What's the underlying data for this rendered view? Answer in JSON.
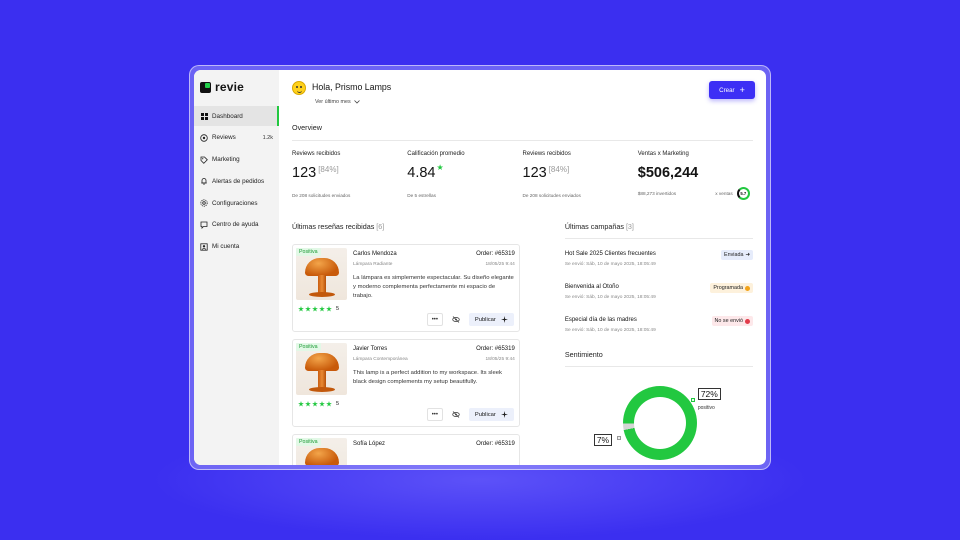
{
  "app": {
    "name": "revie"
  },
  "sidebar": {
    "items": [
      {
        "label": "Dashboard",
        "icon": "grid-icon",
        "active": true
      },
      {
        "label": "Reviews",
        "icon": "star-circle-icon",
        "badge": "1.2k"
      },
      {
        "label": "Marketing",
        "icon": "tag-icon"
      },
      {
        "label": "Alertas de pedidos",
        "icon": "bell-icon"
      },
      {
        "label": "Configuraciones",
        "icon": "gear-icon"
      },
      {
        "label": "Centro de ayuda",
        "icon": "help-chat-icon"
      },
      {
        "label": "Mi cuenta",
        "icon": "user-icon"
      }
    ]
  },
  "header": {
    "greeting": "Hola, Prismo Lamps",
    "period": "Ver último mes",
    "create_label": "Crear"
  },
  "overview": {
    "title": "Overview",
    "stats": [
      {
        "label": "Reviews recibidos",
        "value": "123",
        "pct": "[84%]",
        "foot": "De 208 solicitudes enviados"
      },
      {
        "label": "Calificación promedio",
        "value": "4.84",
        "star": "★",
        "foot": "De 5 estrellas"
      },
      {
        "label": "Reviews recibidos",
        "value": "123",
        "pct": "[84%]",
        "foot": "De 208 solicitudes enviados"
      },
      {
        "label": "Ventas x Marketing",
        "value": "$506,244",
        "foot": "$88,273 invertidos",
        "foot2": "x ventas",
        "ratio": "5.7"
      }
    ]
  },
  "reviews": {
    "title": "Últimas reseñas recibidas",
    "count": "[6]",
    "items": [
      {
        "sentiment": "Positiva",
        "name": "Carlos Mendoza",
        "order": "Order: #65319",
        "product": "Lámpara Radiante",
        "date": "18/05/25 9:44",
        "text": "La lámpara es simplemente espectacular. Su diseño elegante y moderno complementa perfectamente mi espacio de trabajo.",
        "rating": "5",
        "more": "•••",
        "publish": "Publicar"
      },
      {
        "sentiment": "Positiva",
        "name": "Javier Torres",
        "order": "Order: #65319",
        "product": "Lámpara Contemporánea",
        "date": "18/05/25 9:44",
        "text": "This lamp is a perfect addition to my workspace. Its sleek black design complements my setup beautifully.",
        "rating": "5",
        "more": "•••",
        "publish": "Publicar"
      },
      {
        "sentiment": "Positiva",
        "name": "Sofía López",
        "order": "Order: #65319"
      }
    ]
  },
  "campaigns": {
    "title": "Últimas campañas",
    "count": "[3]",
    "items": [
      {
        "name": "Hot Sale 2025 Clientes frecuentes",
        "date": "Se envió: Sáb, 10 de mayo 2025, 18:05:49",
        "status": "Enviada",
        "status_icon": "➜",
        "kind": "sent"
      },
      {
        "name": "Bienvenida al Otoño",
        "date": "Se envió: Sáb, 10 de mayo 2025, 18:05:49",
        "status": "Programada",
        "kind": "sched",
        "dot_color": "#f2a31b"
      },
      {
        "name": "Especial día de las madres",
        "date": "Se envió: Sáb, 10 de mayo 2025, 18:05:49",
        "status": "No se envió",
        "kind": "fail",
        "dot_color": "#e23b4a"
      }
    ]
  },
  "sentiment": {
    "title": "Sentimiento",
    "positive_pct": "72%",
    "positive_label": "positivo",
    "other_pct": "7%"
  },
  "colors": {
    "accent": "#3d2ff5",
    "green": "#22c840",
    "background": "#3b2ff0"
  }
}
